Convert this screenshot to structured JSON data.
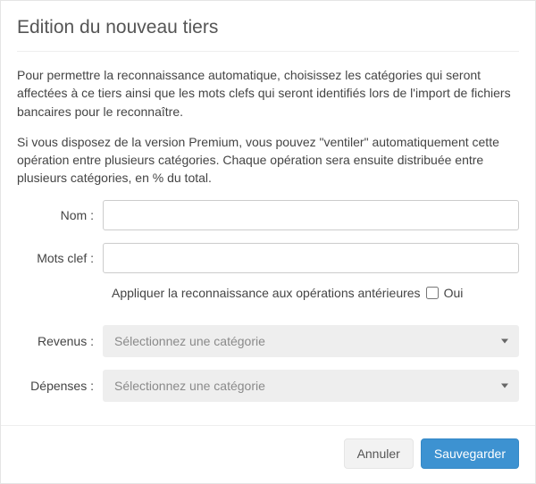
{
  "header": {
    "title": "Edition du nouveau tiers"
  },
  "help": {
    "paragraph1": "Pour permettre la reconnaissance automatique, choisissez les catégories qui seront affectées à ce tiers ainsi que les mots clefs qui seront identifiés lors de l'import de fichiers bancaires pour le reconnaître.",
    "paragraph2": "Si vous disposez de la version Premium, vous pouvez \"ventiler\" automatiquement cette opération entre plusieurs catégories. Chaque opération sera ensuite distribuée entre plusieurs catégories, en % du total."
  },
  "form": {
    "name_label": "Nom :",
    "keywords_label": "Mots clef :",
    "apply_label": "Appliquer la reconnaissance aux opérations antérieures",
    "apply_yes": "Oui",
    "revenues_label": "Revenus :",
    "expenses_label": "Dépenses :",
    "select_placeholder": "Sélectionnez une catégorie"
  },
  "footer": {
    "cancel": "Annuler",
    "save": "Sauvegarder"
  }
}
